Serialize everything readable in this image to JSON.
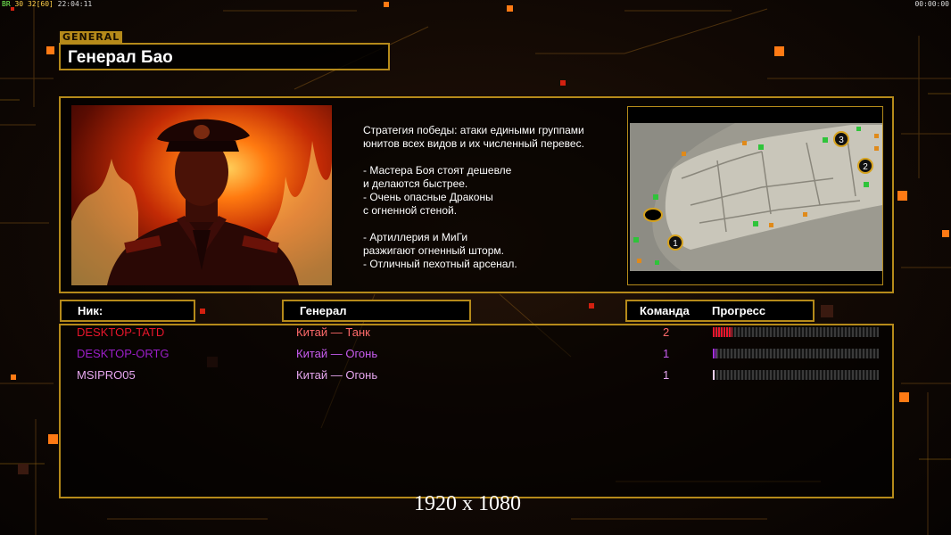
{
  "hud": {
    "fps_label": "BR",
    "fps_value": "30",
    "fps_cap": "32[60]",
    "clock": "22:04:11",
    "timer": "00:00:00"
  },
  "general_tag": "GENERAL",
  "general_name": "Генерал Бао",
  "description": "Стратегия победы: атаки едиными группами\nюнитов всех видов и их численный перевес.\n\n- Мастера Боя стоят дешевле\nи делаются быстрее.\n- Очень опасные Драконы\nс огненной стеной.\n\n- Артиллерия и МиГи\nразжигают огненный шторм.\n- Отличный пехотный арсенал.",
  "map": {
    "spawn_labels": [
      "1",
      "2",
      "3"
    ]
  },
  "columns": {
    "nick": "Ник:",
    "general": "Генерал",
    "team": "Команда",
    "progress": "Прогресс"
  },
  "players": [
    {
      "nick": "DESKTOP-TATD",
      "general": "Китай — Танк",
      "team": "2",
      "progress": 0.12,
      "nick_color": "#e8162c",
      "general_color": "#ff6a6a",
      "bar_color": "#e8162c"
    },
    {
      "nick": "DESKTOP-ORTG",
      "general": "Китай — Огонь",
      "team": "1",
      "progress": 0.02,
      "nick_color": "#9b1ec8",
      "general_color": "#c85cf0",
      "bar_color": "#a430e0"
    },
    {
      "nick": "MSIPRO05",
      "general": "Китай — Огонь",
      "team": "1",
      "progress": 0.01,
      "nick_color": "#e6a6ee",
      "general_color": "#e6a6ee",
      "bar_color": "#f0d0f4"
    }
  ],
  "resolution": "1920 x 1080",
  "colors": {
    "accent": "#b58a1a",
    "background": "#0a0604"
  }
}
